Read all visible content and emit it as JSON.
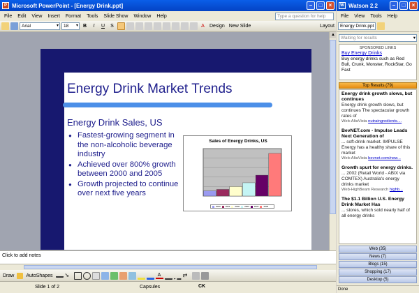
{
  "powerpoint": {
    "title": "Microsoft PowerPoint - [Energy Drink.ppt]",
    "menu": [
      "File",
      "Edit",
      "View",
      "Insert",
      "Format",
      "Tools",
      "Slide Show",
      "Window",
      "Help"
    ],
    "ask_placeholder": "Type a question for help",
    "font_name": "Arial",
    "font_size": "18",
    "design_label": "Design",
    "new_slide_label": "New Slide",
    "layout_label": "Layout",
    "slide": {
      "title": "Energy Drink Market Trends",
      "subtitle": "Energy Drink Sales, US",
      "bullets": [
        "Fastest-growing segment in the non-alcoholic beverage industry",
        "Achieved over 800% growth between 2000 and 2005",
        "Growth projected to continue over next five years"
      ]
    },
    "notes_placeholder": "Click to add notes",
    "draw_label": "Draw",
    "autoshapes_label": "AutoShapes",
    "status": {
      "slide": "Slide 1 of 2",
      "design": "Capsules",
      "lang": "CK"
    }
  },
  "chart_data": {
    "type": "bar",
    "title": "Sales of Energy Drinks, US",
    "categories": [
      "2000",
      "2001",
      "2002",
      "2003",
      "2004",
      "2005"
    ],
    "values": [
      11,
      14,
      20,
      28,
      44,
      90
    ],
    "colors": [
      "#9a9af0",
      "#9a2a5e",
      "#fffecc",
      "#c4f4f4",
      "#660066",
      "#ff7a7a"
    ],
    "ylim": [
      0,
      100
    ],
    "grid": true,
    "legend_position": "bottom"
  },
  "watson": {
    "title": "Watson 2.2",
    "menu": [
      "File",
      "View",
      "Tools",
      "Help"
    ],
    "doc_label": "Energy Drink.ppt",
    "status_select": "Waiting for results",
    "sponsored": {
      "header": "SPONSORED LINKS",
      "link": "Buy Energy Drinks",
      "body": "Buy energy drinks such as Red Bull, Crunk, Monster, RockStar, Go Fast"
    },
    "top_results_label": "Top Results",
    "top_results_count": "(79)",
    "results": [
      {
        "title": "Energy drink growth slows, but continues",
        "snippet": "Energy drink growth slows, but continues The spectacular growth rates of",
        "source": "Web-AltaVista",
        "link": "nutraingredients...."
      },
      {
        "title": "BevNET.com - Impulse Leads Next Generation of",
        "snippet": "... soft-drink market. IMPULSE Energy has a healthy share of this market",
        "source": "Web-AltaVista",
        "link": "bevnet.com/new..."
      },
      {
        "title": "Growth spurt for energy drinks.",
        "snippet": "... 2002 (Retail World - ABIX via COMTEX) Australia's energy drinks market",
        "source": "Web-HighBeam Research",
        "link": "highb..."
      },
      {
        "title": "The $1.1 Billion U.S. Energy Drink Market Has",
        "snippet": "... stores, which sold nearly half of all energy drinks",
        "source": "",
        "link": ""
      }
    ],
    "categories": [
      {
        "label": "Web",
        "count": "(35)"
      },
      {
        "label": "News",
        "count": "(7)"
      },
      {
        "label": "Blogs",
        "count": "(15)"
      },
      {
        "label": "Shopping",
        "count": "(17)"
      },
      {
        "label": "Desktop",
        "count": "(5)"
      }
    ],
    "status_text": "Done"
  },
  "colors": {
    "slide_dark_blue": "#17186f",
    "slide_accent": "#4c8fe8",
    "top_results": "#f0a030",
    "xp_title": "#0a5ee8"
  }
}
